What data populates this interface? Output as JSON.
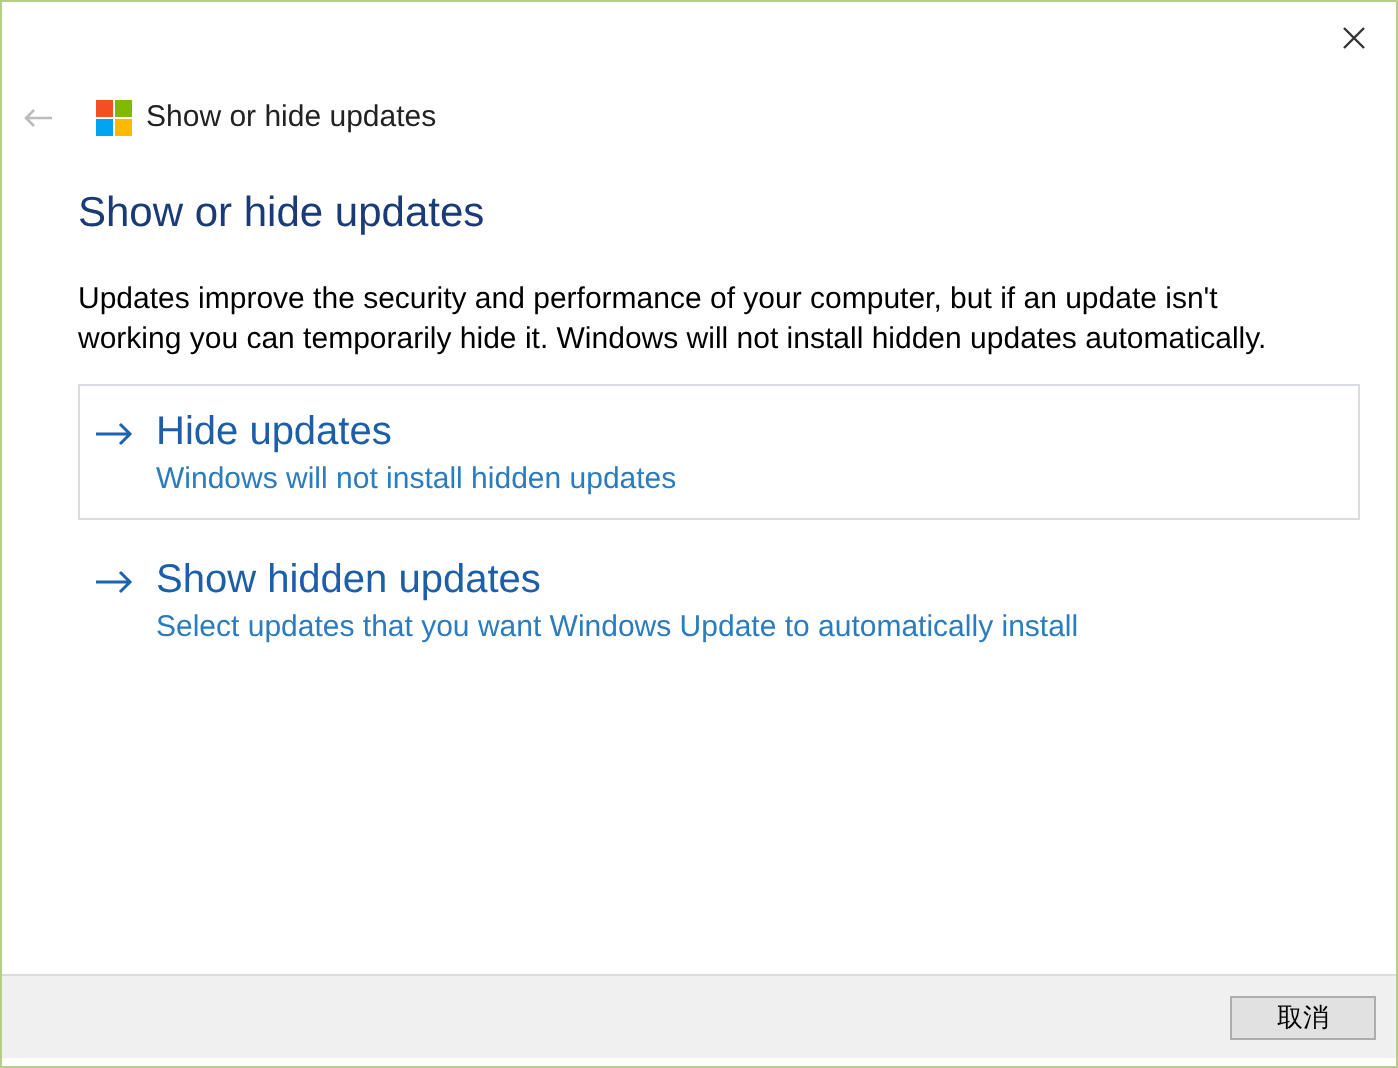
{
  "window": {
    "title": "Show or hide updates",
    "back_disabled": true
  },
  "heading": "Show or hide updates",
  "description": "Updates improve the security and performance of your computer, but if an update isn't working you can temporarily hide it. Windows will not install hidden updates automatically.",
  "options": [
    {
      "title": "Hide updates",
      "subtitle": "Windows will not install hidden updates",
      "selected": true
    },
    {
      "title": "Show hidden updates",
      "subtitle": "Select updates that you want Windows Update to automatically install",
      "selected": false
    }
  ],
  "buttons": [
    "取消"
  ]
}
